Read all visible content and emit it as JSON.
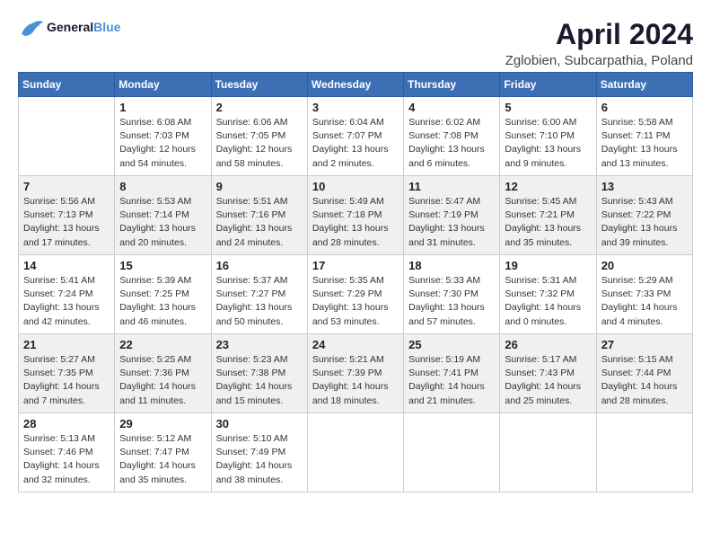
{
  "logo": {
    "text_general": "General",
    "text_blue": "Blue"
  },
  "header": {
    "title": "April 2024",
    "subtitle": "Zglobien, Subcarpathia, Poland"
  },
  "weekdays": [
    "Sunday",
    "Monday",
    "Tuesday",
    "Wednesday",
    "Thursday",
    "Friday",
    "Saturday"
  ],
  "weeks": [
    [
      {
        "day": "",
        "info": ""
      },
      {
        "day": "1",
        "info": "Sunrise: 6:08 AM\nSunset: 7:03 PM\nDaylight: 12 hours\nand 54 minutes."
      },
      {
        "day": "2",
        "info": "Sunrise: 6:06 AM\nSunset: 7:05 PM\nDaylight: 12 hours\nand 58 minutes."
      },
      {
        "day": "3",
        "info": "Sunrise: 6:04 AM\nSunset: 7:07 PM\nDaylight: 13 hours\nand 2 minutes."
      },
      {
        "day": "4",
        "info": "Sunrise: 6:02 AM\nSunset: 7:08 PM\nDaylight: 13 hours\nand 6 minutes."
      },
      {
        "day": "5",
        "info": "Sunrise: 6:00 AM\nSunset: 7:10 PM\nDaylight: 13 hours\nand 9 minutes."
      },
      {
        "day": "6",
        "info": "Sunrise: 5:58 AM\nSunset: 7:11 PM\nDaylight: 13 hours\nand 13 minutes."
      }
    ],
    [
      {
        "day": "7",
        "info": "Sunrise: 5:56 AM\nSunset: 7:13 PM\nDaylight: 13 hours\nand 17 minutes."
      },
      {
        "day": "8",
        "info": "Sunrise: 5:53 AM\nSunset: 7:14 PM\nDaylight: 13 hours\nand 20 minutes."
      },
      {
        "day": "9",
        "info": "Sunrise: 5:51 AM\nSunset: 7:16 PM\nDaylight: 13 hours\nand 24 minutes."
      },
      {
        "day": "10",
        "info": "Sunrise: 5:49 AM\nSunset: 7:18 PM\nDaylight: 13 hours\nand 28 minutes."
      },
      {
        "day": "11",
        "info": "Sunrise: 5:47 AM\nSunset: 7:19 PM\nDaylight: 13 hours\nand 31 minutes."
      },
      {
        "day": "12",
        "info": "Sunrise: 5:45 AM\nSunset: 7:21 PM\nDaylight: 13 hours\nand 35 minutes."
      },
      {
        "day": "13",
        "info": "Sunrise: 5:43 AM\nSunset: 7:22 PM\nDaylight: 13 hours\nand 39 minutes."
      }
    ],
    [
      {
        "day": "14",
        "info": "Sunrise: 5:41 AM\nSunset: 7:24 PM\nDaylight: 13 hours\nand 42 minutes."
      },
      {
        "day": "15",
        "info": "Sunrise: 5:39 AM\nSunset: 7:25 PM\nDaylight: 13 hours\nand 46 minutes."
      },
      {
        "day": "16",
        "info": "Sunrise: 5:37 AM\nSunset: 7:27 PM\nDaylight: 13 hours\nand 50 minutes."
      },
      {
        "day": "17",
        "info": "Sunrise: 5:35 AM\nSunset: 7:29 PM\nDaylight: 13 hours\nand 53 minutes."
      },
      {
        "day": "18",
        "info": "Sunrise: 5:33 AM\nSunset: 7:30 PM\nDaylight: 13 hours\nand 57 minutes."
      },
      {
        "day": "19",
        "info": "Sunrise: 5:31 AM\nSunset: 7:32 PM\nDaylight: 14 hours\nand 0 minutes."
      },
      {
        "day": "20",
        "info": "Sunrise: 5:29 AM\nSunset: 7:33 PM\nDaylight: 14 hours\nand 4 minutes."
      }
    ],
    [
      {
        "day": "21",
        "info": "Sunrise: 5:27 AM\nSunset: 7:35 PM\nDaylight: 14 hours\nand 7 minutes."
      },
      {
        "day": "22",
        "info": "Sunrise: 5:25 AM\nSunset: 7:36 PM\nDaylight: 14 hours\nand 11 minutes."
      },
      {
        "day": "23",
        "info": "Sunrise: 5:23 AM\nSunset: 7:38 PM\nDaylight: 14 hours\nand 15 minutes."
      },
      {
        "day": "24",
        "info": "Sunrise: 5:21 AM\nSunset: 7:39 PM\nDaylight: 14 hours\nand 18 minutes."
      },
      {
        "day": "25",
        "info": "Sunrise: 5:19 AM\nSunset: 7:41 PM\nDaylight: 14 hours\nand 21 minutes."
      },
      {
        "day": "26",
        "info": "Sunrise: 5:17 AM\nSunset: 7:43 PM\nDaylight: 14 hours\nand 25 minutes."
      },
      {
        "day": "27",
        "info": "Sunrise: 5:15 AM\nSunset: 7:44 PM\nDaylight: 14 hours\nand 28 minutes."
      }
    ],
    [
      {
        "day": "28",
        "info": "Sunrise: 5:13 AM\nSunset: 7:46 PM\nDaylight: 14 hours\nand 32 minutes."
      },
      {
        "day": "29",
        "info": "Sunrise: 5:12 AM\nSunset: 7:47 PM\nDaylight: 14 hours\nand 35 minutes."
      },
      {
        "day": "30",
        "info": "Sunrise: 5:10 AM\nSunset: 7:49 PM\nDaylight: 14 hours\nand 38 minutes."
      },
      {
        "day": "",
        "info": ""
      },
      {
        "day": "",
        "info": ""
      },
      {
        "day": "",
        "info": ""
      },
      {
        "day": "",
        "info": ""
      }
    ]
  ]
}
